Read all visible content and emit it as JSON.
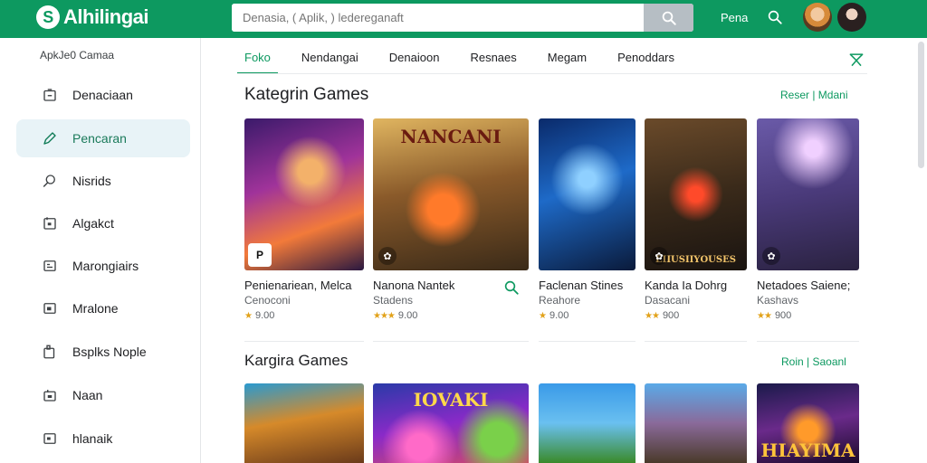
{
  "header": {
    "logo_text": "Alhilingai",
    "search_placeholder": "Denasia, ( Aplik, ) ledereganaft",
    "text_link": "Pena"
  },
  "sidebar": {
    "heading": "ApkJe0 Camaa",
    "items": [
      {
        "label": "Denaciaan",
        "icon": "gamepad-icon"
      },
      {
        "label": "Pencaran",
        "icon": "pencil-icon",
        "active": true
      },
      {
        "label": "Nisrids",
        "icon": "search-icon"
      },
      {
        "label": "Algakct",
        "icon": "app-icon"
      },
      {
        "label": "Marongiairs",
        "icon": "list-icon"
      },
      {
        "label": "Mralone",
        "icon": "window-icon"
      },
      {
        "label": "Bsplks Nople",
        "icon": "puzzle-icon"
      },
      {
        "label": "Naan",
        "icon": "home-icon"
      },
      {
        "label": "hlanaik",
        "icon": "card-icon"
      }
    ]
  },
  "tabs": [
    "Foko",
    "Nendangai",
    "Denaioon",
    "Resnaes",
    "Megam",
    "Penoddars"
  ],
  "section1": {
    "title": "Kategrin Games",
    "link": "Reser | Mdani",
    "cards": [
      {
        "title": "Penienariean, Melca",
        "sub": "Cenoconi",
        "rating": "9.00",
        "stars": 1
      },
      {
        "title": "Nanona Nantek",
        "sub": "Stadens",
        "rating": "9.00",
        "stars": 3
      },
      {
        "title": "Faclenan Stines",
        "sub": "Reahore",
        "rating": "9.00",
        "stars": 1
      },
      {
        "title": "Kanda Ia Dohrg",
        "sub": "Dasacani",
        "rating": "900",
        "stars": 2
      },
      {
        "title": "Netadoes Saiene;",
        "sub": "Kashavs",
        "rating": "900",
        "stars": 2
      }
    ],
    "art_texts": [
      "",
      "NANCANI",
      "",
      "EIIUSIIYOUSES",
      ""
    ]
  },
  "section2": {
    "title": "Kargira Games",
    "link": "Roin | Saoanl",
    "art_texts": [
      "",
      "IOVAKI",
      "",
      "",
      "HIAYIMA"
    ]
  },
  "colors": {
    "brand": "#0d9960",
    "accent_star": "#e2a21a"
  }
}
